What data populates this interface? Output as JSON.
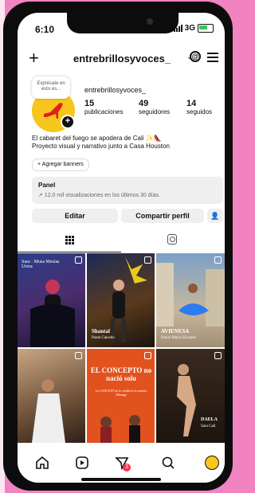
{
  "status": {
    "time": "6:10",
    "network": "3G"
  },
  "header": {
    "username": "entrebrillosyvoces_"
  },
  "profile": {
    "bubble_text": "Exprésate en esto es...",
    "name": "entrebrillosyvoces_",
    "stats": [
      {
        "value": "15",
        "label": "publicaciones"
      },
      {
        "value": "49",
        "label": "seguidores"
      },
      {
        "value": "14",
        "label": "seguidos"
      }
    ],
    "bio_line1": "El cabaret del fuego se apodera de Cali ✨👠",
    "bio_line2": "Proyecto visual y narrativo junto a Casa Houston",
    "banners_label": "+ Agregar banners"
  },
  "panel": {
    "title": "Panel",
    "subtitle": "↗ 12,0 mil visualizaciones en los últimos 30 días."
  },
  "buttons": {
    "edit": "Editar",
    "share": "Compartir perfil"
  },
  "posts": [
    {
      "caption": "Sara · Musa Mesías Urrea"
    },
    {
      "caption": "Shantal",
      "sub": "Pauta Caicedo"
    },
    {
      "caption": "AVIENESA",
      "sub": "Dunal Mario Elcazelo"
    },
    {
      "caption": ""
    },
    {
      "caption": "EL CONCEPTO no nació solo",
      "sub": "La CANCIÓN de la ciudad es la nuestra Milonga"
    },
    {
      "caption": "DAELA",
      "sub": "Sara Cali"
    }
  ],
  "nav": {
    "notifications_badge": "3"
  },
  "colors": {
    "accent": "#f6c61c",
    "shoe": "#e0201c",
    "badge": "#ff2e55",
    "frame": "#f184c0",
    "poster_orange": "#e2521e"
  }
}
